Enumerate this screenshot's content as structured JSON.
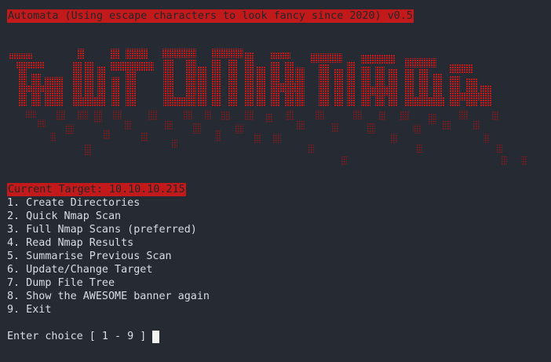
{
  "terminal": {
    "header": "Automata (Using escape characters to look fancy since 2020) v0.5",
    "banner_alt": "AUTOMATA",
    "current_target": "Current Target: 10.10.10.215",
    "menu": [
      "1. Create Directories",
      "2. Quick Nmap Scan",
      "3. Full Nmap Scans (preferred)",
      "4. Read Nmap Results",
      "5. Summarise Previous Scan",
      "6. Update/Change Target",
      "7. Dump File Tree",
      "8. Show the AWESOME banner again",
      "9. Exit"
    ],
    "prompt": "Enter choice [ 1 - 9 ]"
  },
  "colors": {
    "background": "#262a33",
    "accent": "#c21a1a",
    "text": "#d8dce6",
    "cursor": "#f2f2f2"
  }
}
